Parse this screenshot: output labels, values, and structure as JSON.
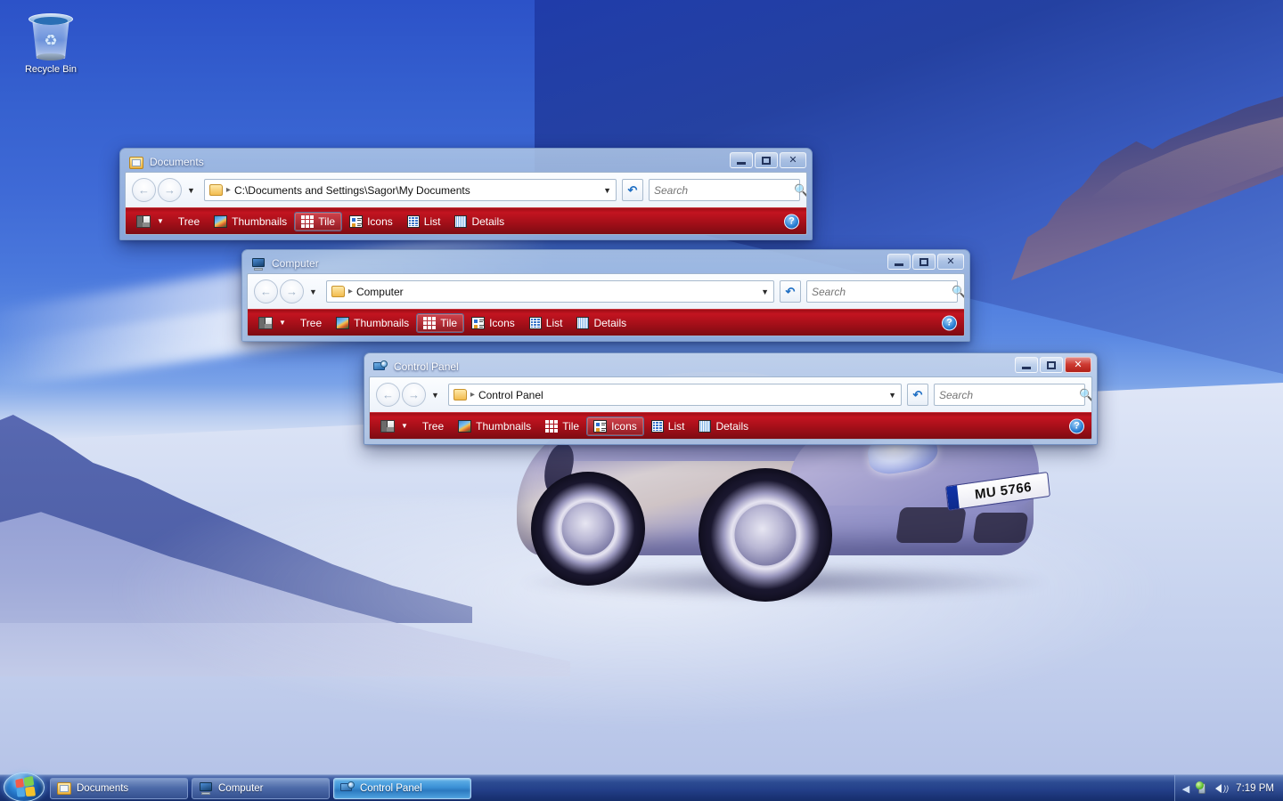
{
  "desktop": {
    "icons": [
      {
        "name": "recycle-bin",
        "label": "Recycle Bin",
        "icon": "recycle-bin-icon"
      }
    ],
    "wallpaper": {
      "description": "Porsche 911 Turbo on a snow plain with mountains",
      "license_plate_prefix": "S",
      "license_plate": "MU 5766",
      "sky_color": "#2c52c8",
      "snow_color": "#d3ddf3"
    }
  },
  "theme": {
    "toolbar_red": "#a50f19",
    "toolbar_red_light": "#c31420",
    "accent_blue": "#2a7fd4",
    "taskbar_blue": "#24408a"
  },
  "windows": [
    {
      "id": "documents",
      "title": "Documents",
      "icon": "documents-folder-icon",
      "active": false,
      "address": {
        "path": "C:\\Documents and Settings\\Sagor\\My Documents",
        "folder_icon": "folder-icon",
        "dropdown_icon": "chevron-down-icon"
      },
      "nav": {
        "back_label": "Back",
        "forward_label": "Forward",
        "history_label": "Recent Pages",
        "refresh_label": "Refresh"
      },
      "search": {
        "placeholder": "Search",
        "value": "",
        "icon": "search-icon"
      },
      "titlebar_buttons": {
        "minimize": "Minimize",
        "maximize": "Maximize",
        "close": "Close"
      },
      "toolbar": {
        "layout_label": "Layout",
        "help_label": "Help",
        "selected": "Tile",
        "items": [
          {
            "label": "Tree",
            "icon": "tree-icon"
          },
          {
            "label": "Thumbnails",
            "icon": "thumbnails-icon"
          },
          {
            "label": "Tile",
            "icon": "tile-icon"
          },
          {
            "label": "Icons",
            "icon": "icons-icon"
          },
          {
            "label": "List",
            "icon": "list-icon"
          },
          {
            "label": "Details",
            "icon": "details-icon"
          }
        ]
      }
    },
    {
      "id": "computer",
      "title": "Computer",
      "icon": "computer-icon",
      "active": false,
      "address": {
        "path": "Computer",
        "folder_icon": "folder-icon",
        "dropdown_icon": "chevron-down-icon"
      },
      "nav": {
        "back_label": "Back",
        "forward_label": "Forward",
        "history_label": "Recent Pages",
        "refresh_label": "Refresh"
      },
      "search": {
        "placeholder": "Search",
        "value": "",
        "icon": "search-icon"
      },
      "titlebar_buttons": {
        "minimize": "Minimize",
        "maximize": "Maximize",
        "close": "Close"
      },
      "toolbar": {
        "layout_label": "Layout",
        "help_label": "Help",
        "selected": "Tile",
        "items": [
          {
            "label": "Tree",
            "icon": "tree-icon"
          },
          {
            "label": "Thumbnails",
            "icon": "thumbnails-icon"
          },
          {
            "label": "Tile",
            "icon": "tile-icon"
          },
          {
            "label": "Icons",
            "icon": "icons-icon"
          },
          {
            "label": "List",
            "icon": "list-icon"
          },
          {
            "label": "Details",
            "icon": "details-icon"
          }
        ]
      }
    },
    {
      "id": "control-panel",
      "title": "Control Panel",
      "icon": "control-panel-icon",
      "active": true,
      "address": {
        "path": "Control Panel",
        "folder_icon": "folder-icon",
        "dropdown_icon": "chevron-down-icon"
      },
      "nav": {
        "back_label": "Back",
        "forward_label": "Forward",
        "history_label": "Recent Pages",
        "refresh_label": "Refresh"
      },
      "search": {
        "placeholder": "Search",
        "value": "",
        "icon": "search-icon"
      },
      "titlebar_buttons": {
        "minimize": "Minimize",
        "maximize": "Maximize",
        "close": "Close"
      },
      "toolbar": {
        "layout_label": "Layout",
        "help_label": "Help",
        "selected": "Icons",
        "items": [
          {
            "label": "Tree",
            "icon": "tree-icon"
          },
          {
            "label": "Thumbnails",
            "icon": "thumbnails-icon"
          },
          {
            "label": "Tile",
            "icon": "tile-icon"
          },
          {
            "label": "Icons",
            "icon": "icons-icon"
          },
          {
            "label": "List",
            "icon": "list-icon"
          },
          {
            "label": "Details",
            "icon": "details-icon"
          }
        ]
      }
    }
  ],
  "taskbar": {
    "start_label": "Start",
    "start_icon": "windows-orb-icon",
    "buttons": [
      {
        "label": "Documents",
        "icon": "documents-folder-icon",
        "active": false
      },
      {
        "label": "Computer",
        "icon": "computer-icon",
        "active": false
      },
      {
        "label": "Control Panel",
        "icon": "control-panel-icon",
        "active": true
      }
    ],
    "tray": {
      "expand_icon": "chevron-left-icon",
      "network_icon": "network-icon",
      "volume_icon": "volume-icon",
      "clock": "7:19 PM"
    }
  }
}
